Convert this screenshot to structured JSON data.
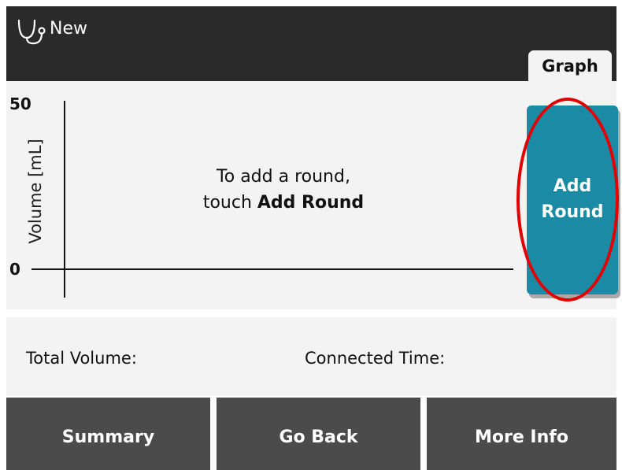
{
  "header": {
    "icon": "stethoscope-icon",
    "title": "New",
    "tab_label": "Graph"
  },
  "graph": {
    "y_max_label": "50",
    "y_min_label": "0",
    "y_axis_label": "Volume [mL]",
    "hint_line1": "To add a round,",
    "hint_line2_prefix": "touch ",
    "hint_line2_bold": "Add Round",
    "add_round_line1": "Add",
    "add_round_line2": "Round"
  },
  "info": {
    "total_volume_label": "Total Volume:",
    "connected_time_label": "Connected Time:"
  },
  "footer": {
    "summary_label": "Summary",
    "go_back_label": "Go Back",
    "more_info_label": "More Info"
  },
  "colors": {
    "header_bg": "#2a2a2a",
    "panel_bg": "#f3f3f3",
    "accent": "#1b8aa4",
    "footer_bg": "#4b4b4b",
    "highlight": "#e30000"
  }
}
